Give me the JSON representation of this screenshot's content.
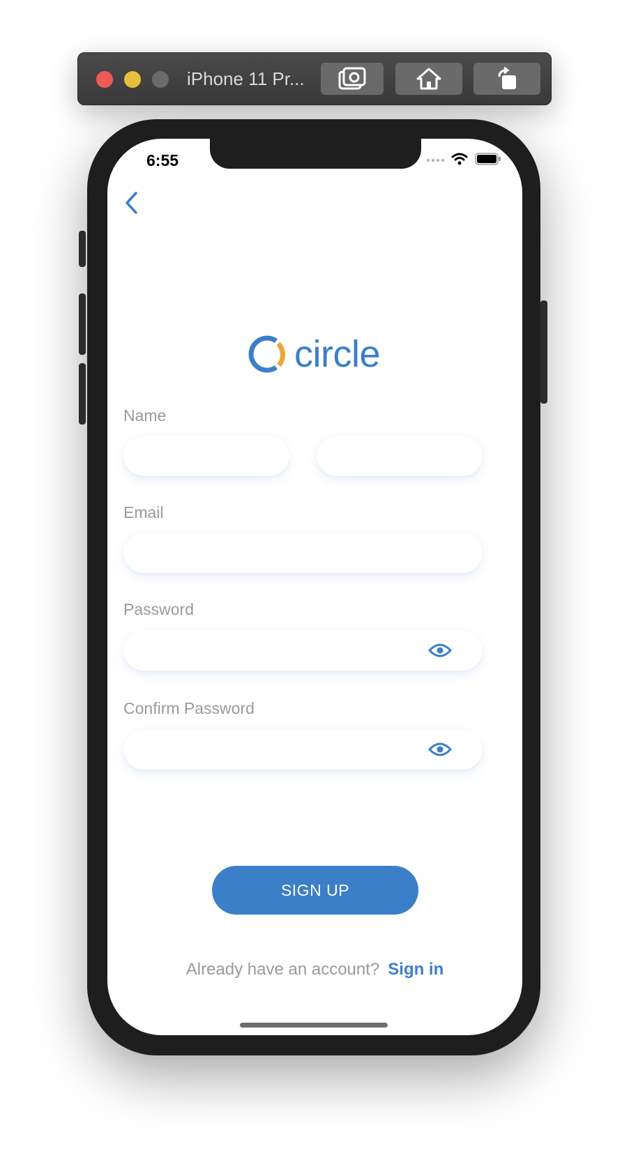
{
  "simulator": {
    "title": "iPhone 11 Pr...",
    "buttons": [
      "screenshot-icon",
      "home-icon",
      "rotate-icon"
    ]
  },
  "status_bar": {
    "time": "6:55",
    "icons": [
      "cellular-icon",
      "wifi-icon",
      "battery-icon"
    ]
  },
  "nav": {
    "back_icon": "chevron-left-icon"
  },
  "logo": {
    "text": "circle",
    "colors": {
      "primary": "#3b7fc9",
      "accent": "#e9a83b"
    }
  },
  "form": {
    "name_label": "Name",
    "first_name_value": "",
    "last_name_value": "",
    "email_label": "Email",
    "email_value": "",
    "password_label": "Password",
    "password_value": "",
    "confirm_password_label": "Confirm Password",
    "confirm_password_value": "",
    "visibility_icon": "eye-icon"
  },
  "actions": {
    "signup_label": "SIGN UP"
  },
  "footer": {
    "prompt": "Already have an account?",
    "link": "Sign in"
  },
  "theme": {
    "accent": "#3b7fc9",
    "label_gray": "#9a9a9a"
  }
}
